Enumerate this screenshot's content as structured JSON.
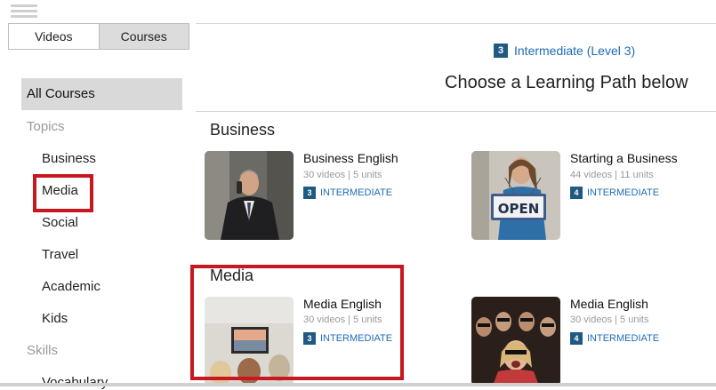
{
  "tabs": [
    "Videos",
    "Courses"
  ],
  "level_indicator": {
    "badge": "3",
    "label": "Intermediate (Level 3)"
  },
  "page_heading": "Choose a Learning Path below",
  "sidebar": {
    "all_courses": "All Courses",
    "topics_heading": "Topics",
    "topics": [
      "Business",
      "Media",
      "Social",
      "Travel",
      "Academic",
      "Kids"
    ],
    "skills_heading": "Skills",
    "skills": [
      "Vocabulary"
    ]
  },
  "sections": [
    {
      "title": "Business",
      "courses": [
        {
          "title": "Business English",
          "meta": "30 videos | 5 units",
          "level_badge": "3",
          "level_label": "INTERMEDIATE"
        },
        {
          "title": "Starting a Business",
          "meta": "44 videos | 11 units",
          "level_badge": "4",
          "level_label": "INTERMEDIATE",
          "sign_text": "OPEN"
        }
      ]
    },
    {
      "title": "Media",
      "courses": [
        {
          "title": "Media English",
          "meta": "30 videos | 5 units",
          "level_badge": "3",
          "level_label": "INTERMEDIATE"
        },
        {
          "title": "Media English",
          "meta": "30 videos | 5 units",
          "level_badge": "4",
          "level_label": "INTERMEDIATE"
        }
      ]
    }
  ],
  "colors": {
    "accent": "#1f6bb5",
    "badge": "#1f5a82",
    "highlight": "#c8171e",
    "selected_bg": "#d9d9d9"
  }
}
